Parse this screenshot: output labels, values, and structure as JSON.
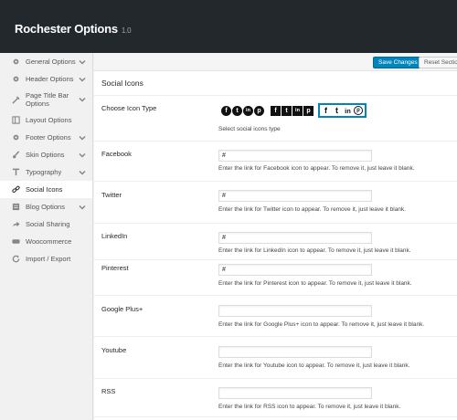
{
  "header": {
    "title": "Rochester Options",
    "version": "1.0"
  },
  "sidebar": {
    "items": [
      {
        "label": "General Options",
        "icon": "gear-icon",
        "chevron": true
      },
      {
        "label": "Header Options",
        "icon": "gear-icon",
        "chevron": true
      },
      {
        "label": "Page Title Bar Options",
        "icon": "tools-icon",
        "chevron": true
      },
      {
        "label": "Layout Options",
        "icon": "layout-icon",
        "chevron": false
      },
      {
        "label": "Footer Options",
        "icon": "gear-icon",
        "chevron": true
      },
      {
        "label": "Skin Options",
        "icon": "brush-icon",
        "chevron": true
      },
      {
        "label": "Typography",
        "icon": "typography-icon",
        "chevron": true
      },
      {
        "label": "Social Icons",
        "icon": "link-icon",
        "chevron": false,
        "active": true
      },
      {
        "label": "Blog Options",
        "icon": "blog-icon",
        "chevron": true
      },
      {
        "label": "Social Sharing",
        "icon": "share-icon",
        "chevron": false
      },
      {
        "label": "Woocommerce",
        "icon": "cart-icon",
        "chevron": false
      },
      {
        "label": "Import / Export",
        "icon": "refresh-icon",
        "chevron": false
      }
    ]
  },
  "toolbar": {
    "save_label": "Save Changes",
    "reset_label": "Reset Section"
  },
  "section": {
    "title": "Social Icons"
  },
  "icon_type": {
    "label": "Choose Icon Type",
    "desc": "Select social icons type",
    "letters": [
      "f",
      "t",
      "in",
      "p"
    ],
    "sets": [
      "circle",
      "square",
      "plain"
    ],
    "selected": "plain"
  },
  "fields": [
    {
      "label": "Facebook",
      "value": "#",
      "placeholder": "",
      "desc": "Enter the link for Facebook icon to appear. To remove it, just leave it blank."
    },
    {
      "label": "Twitter",
      "value": "#",
      "placeholder": "",
      "desc": "Enter the link for Twitter icon to appear. To remove it, just leave it blank."
    },
    {
      "label": "LinkedIn",
      "value": "#",
      "placeholder": "",
      "desc": "Enter the link for LinkedIn icon to appear. To remove it, just leave it blank."
    },
    {
      "label": "Pinterest",
      "value": "#",
      "placeholder": "",
      "desc": "Enter the link for Pinterest icon to appear. To remove it, just leave it blank."
    },
    {
      "label": "Google Plus+",
      "value": "",
      "placeholder": "",
      "desc": "Enter the link for Google Plus+ icon to appear. To remove it, just leave it blank."
    },
    {
      "label": "Youtube",
      "value": "",
      "placeholder": "",
      "desc": "Enter the link for Youtube icon to appear. To remove it, just leave it blank."
    },
    {
      "label": "RSS",
      "value": "",
      "placeholder": "",
      "desc": "Enter the link for RSS icon to appear. To remove it, just leave it blank."
    }
  ],
  "colors": {
    "header_bg": "#23282d",
    "accent": "#0085ba"
  }
}
